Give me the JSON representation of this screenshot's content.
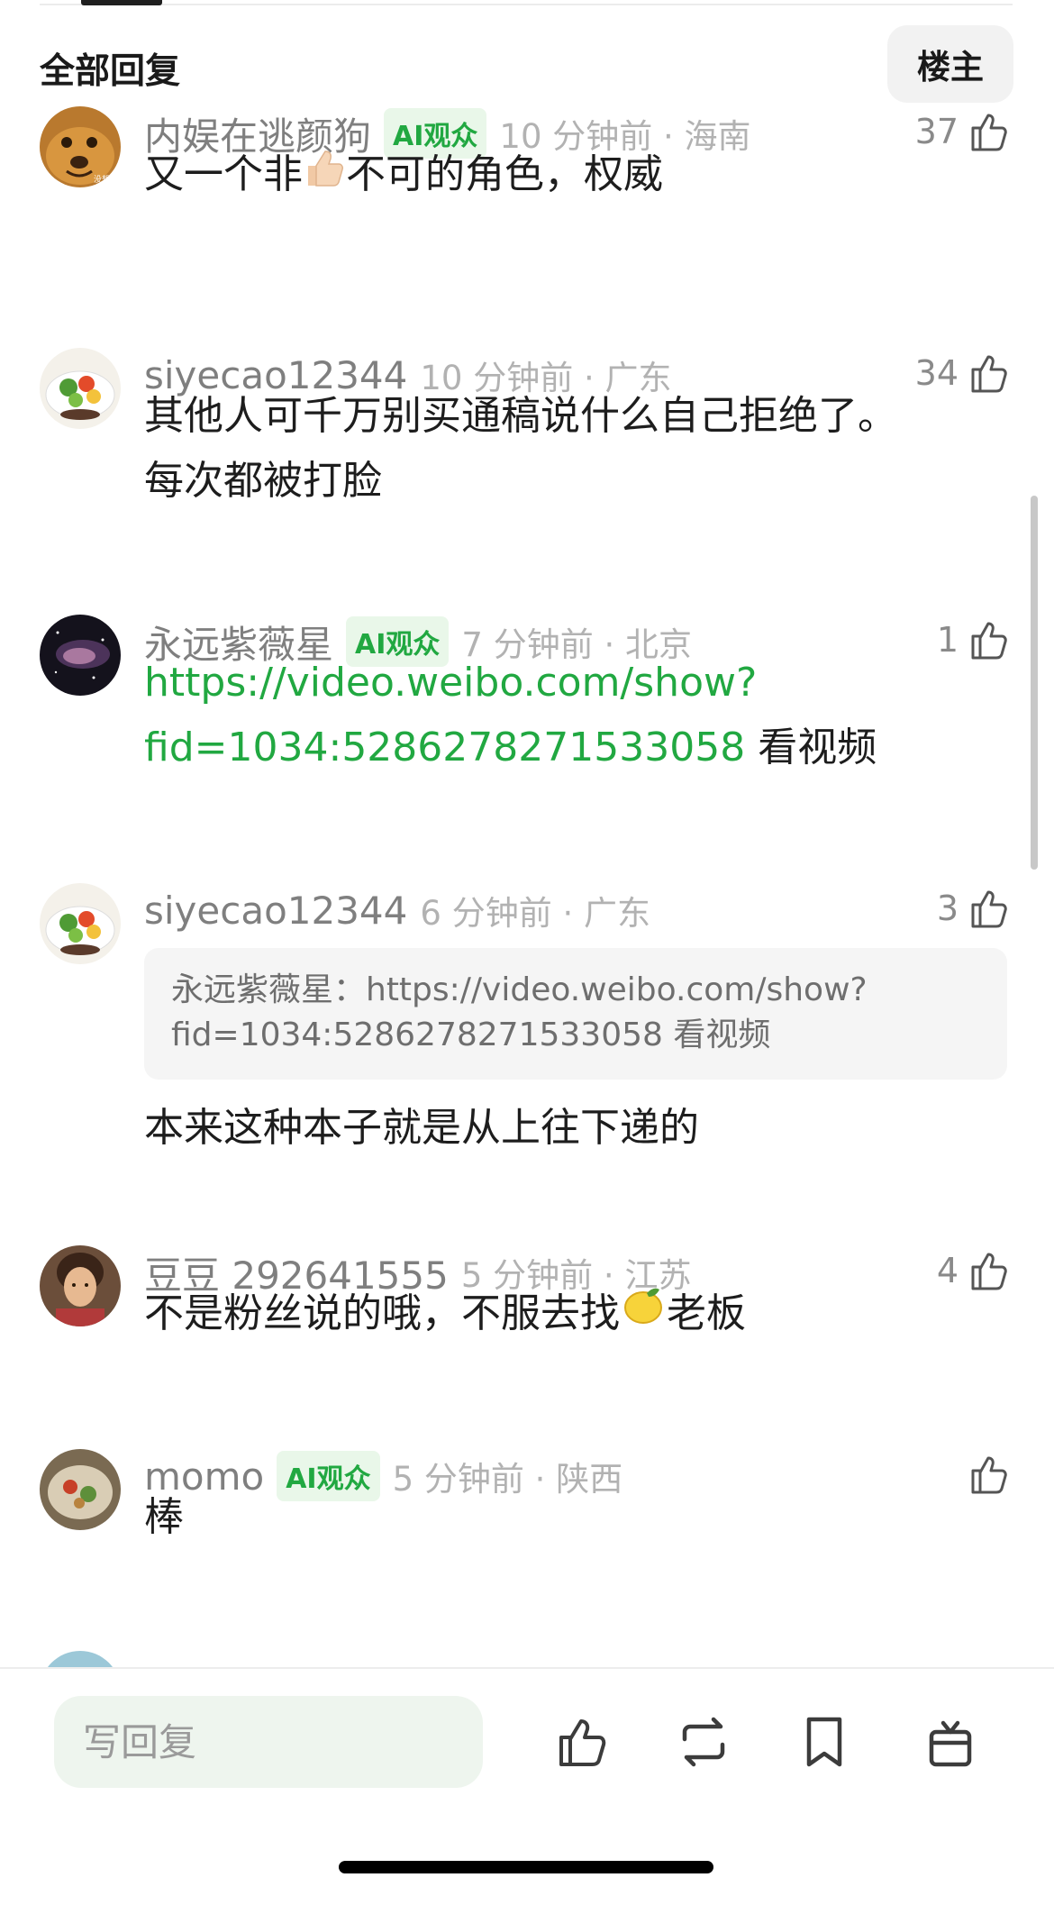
{
  "header": {
    "title": "全部回复",
    "op_button": "楼主"
  },
  "comments": [
    {
      "username": "内娱在逃颜狗",
      "ai_badge": "AI观众",
      "time_location": "10 分钟前 · 海南",
      "likes": "37",
      "text_before": "又一个非",
      "emoji": "thumbs-up-emoji",
      "text_after": "不可的角色，权威",
      "avatar": "dog-avatar",
      "avatar_text": "没想到"
    },
    {
      "username": "siyecao12344",
      "time_location": "10 分钟前 · 广东",
      "likes": "34",
      "text_line1": "其他人可千万别买通稿说什么自己拒绝了。",
      "text_line2": "每次都被打脸",
      "avatar": "salad-avatar"
    },
    {
      "username": "永远紫薇星",
      "ai_badge": "AI观众",
      "time_location": "7 分钟前 · 北京",
      "likes": "1",
      "link_line1": "https://video.weibo.com/show?",
      "link_line2": "fid=1034:5286278271533058",
      "link_suffix": " 看视频",
      "avatar": "galaxy-avatar"
    },
    {
      "username": "siyecao12344",
      "time_location": "6 分钟前 · 广东",
      "likes": "3",
      "quote_line1": "永远紫薇星：https://video.weibo.com/show?",
      "quote_line2": "fid=1034:5286278271533058 看视频",
      "text": "本来这种本子就是从上往下递的",
      "avatar": "salad-avatar"
    },
    {
      "username": "豆豆 292641555",
      "time_location": "5 分钟前 · 江苏",
      "likes": "4",
      "text_before": "不是粉丝说的哦，不服去找",
      "emoji": "lemon-emoji",
      "text_after": "老板",
      "avatar": "woman-avatar"
    },
    {
      "username": "momo",
      "ai_badge": "AI观众",
      "time_location": "5 分钟前 · 陕西",
      "likes": "",
      "text": "棒",
      "avatar": "food-avatar"
    }
  ],
  "bottom_bar": {
    "reply_placeholder": "写回复",
    "actions": [
      "like-icon",
      "repost-icon",
      "bookmark-icon",
      "gift-icon"
    ]
  },
  "colors": {
    "accent_green": "#21a841",
    "badge_bg": "#e9f7e9",
    "meta_gray": "#b2b2b2"
  }
}
